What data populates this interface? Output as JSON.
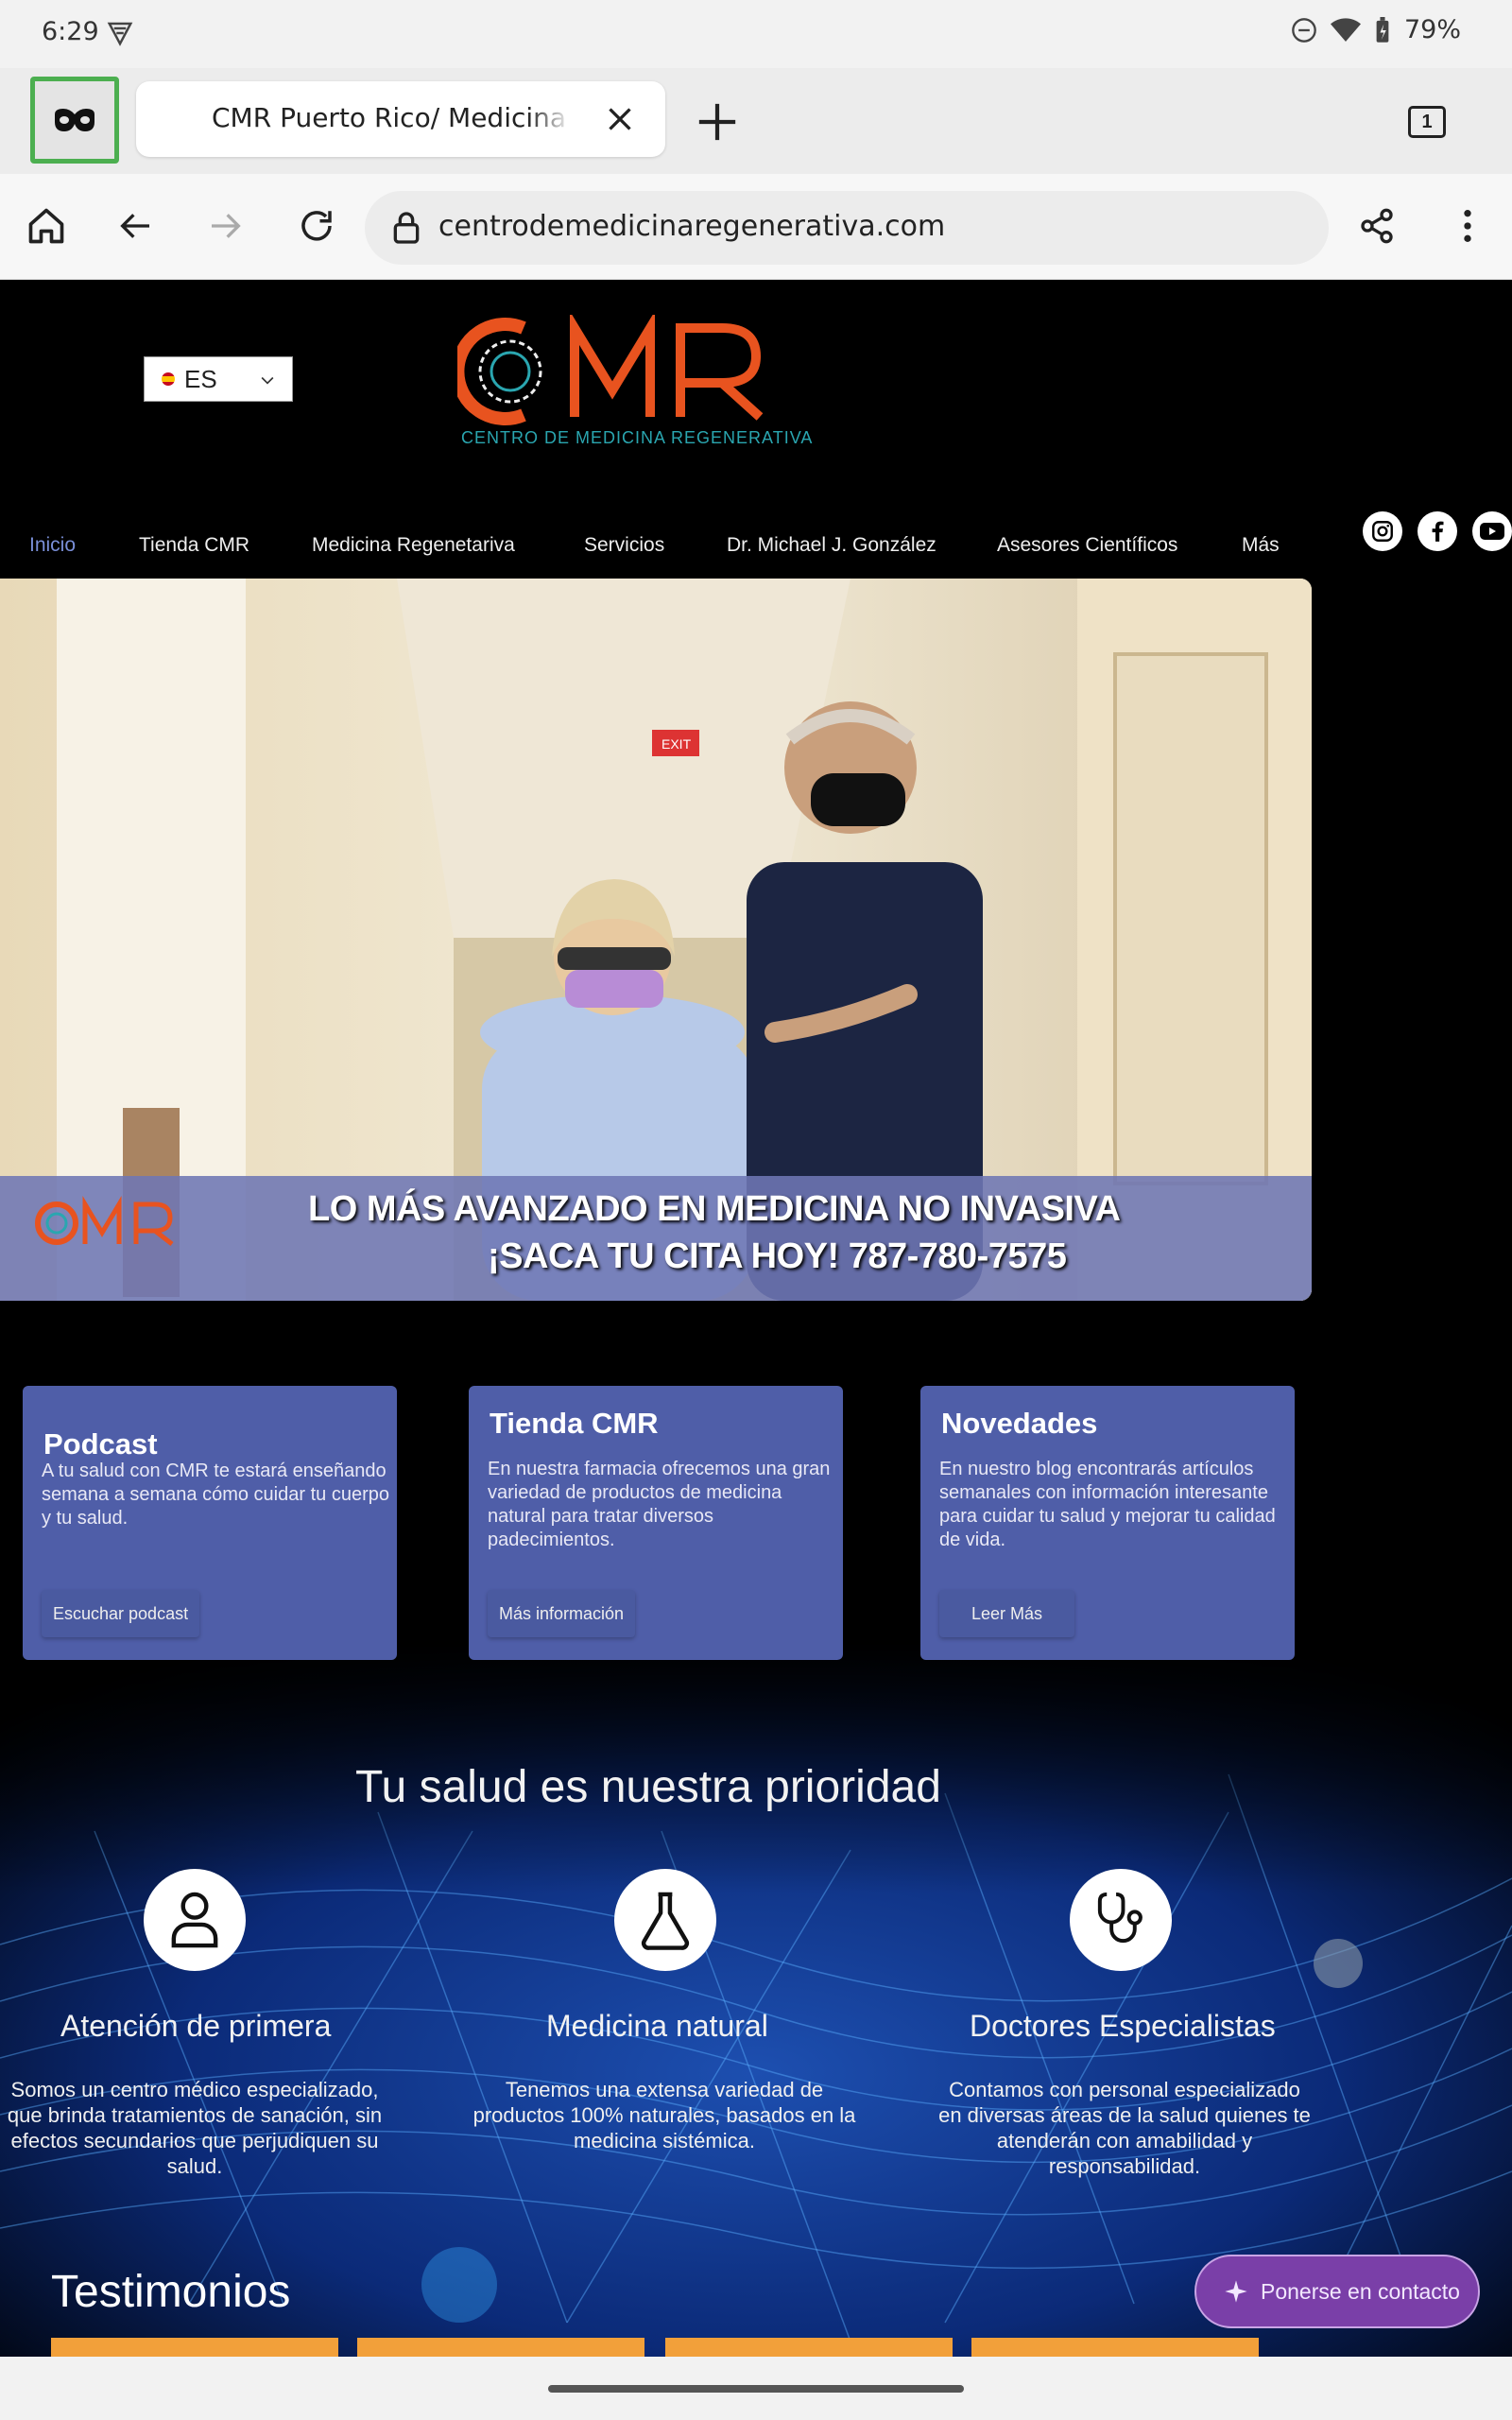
{
  "status_bar": {
    "time": "6:29",
    "battery": "79%"
  },
  "browser": {
    "tab_title": "CMR Puerto Rico/ Medicina Regenerativa",
    "tab_count": "1",
    "url": "centrodemedicinaregenerativa.com"
  },
  "site": {
    "language": "ES",
    "logo_text": "CMR",
    "logo_subtitle": "CENTRO DE MEDICINA REGENERATIVA",
    "nav": [
      {
        "label": "Inicio"
      },
      {
        "label": "Tienda CMR"
      },
      {
        "label": "Medicina Regenetariva"
      },
      {
        "label": "Servicios"
      },
      {
        "label": "Dr. Michael J. González"
      },
      {
        "label": "Asesores Científicos"
      },
      {
        "label": "Más"
      }
    ],
    "social_icons": [
      "instagram-icon",
      "facebook-icon",
      "youtube-icon"
    ],
    "hero": {
      "banner_line1": "LO MÁS AVANZADO EN MEDICINA NO INVASIVA",
      "banner_line2": "¡SACA TU CITA HOY!  787-780-7575",
      "exit_sign": "EXIT"
    },
    "cards": [
      {
        "title": "Podcast",
        "text": "A tu salud con CMR te estará enseñando semana a semana cómo cuidar tu cuerpo y tu salud.",
        "button": "Escuchar podcast"
      },
      {
        "title": "Tienda CMR",
        "text": "En nuestra farmacia ofrecemos una gran variedad de productos de medicina natural para tratar diversos padecimientos.",
        "button": "Más información"
      },
      {
        "title": "Novedades",
        "text": "En nuestro blog encontrarás artículos semanales con información interesante para cuidar tu salud y mejorar tu calidad de vida.",
        "button": "Leer Más"
      }
    ],
    "section_title": "Tu salud es nuestra prioridad",
    "features": [
      {
        "icon": "person-icon",
        "title": "Atención de primera",
        "text": "Somos un centro médico especializado, que brinda tratamientos de sanación, sin efectos secundarios que perjudiquen su salud."
      },
      {
        "icon": "flask-icon",
        "title": "Medicina natural",
        "text": "Tenemos una extensa variedad de productos 100% naturales, basados en la medicina sistémica."
      },
      {
        "icon": "stethoscope-icon",
        "title": "Doctores Especialistas",
        "text": "Contamos con personal especializado en diversas áreas de la salud quienes te atenderán con amabilidad y responsabilidad."
      }
    ],
    "testimonials_title": "Testimonios",
    "contact_button": "Ponerse en contacto"
  },
  "colors": {
    "accent": "#4f5ea8",
    "logo_orange": "#e8531f",
    "logo_teal": "#2aa6b0",
    "orange_bar": "#f2a03a",
    "contact": "#7a3fa8"
  }
}
